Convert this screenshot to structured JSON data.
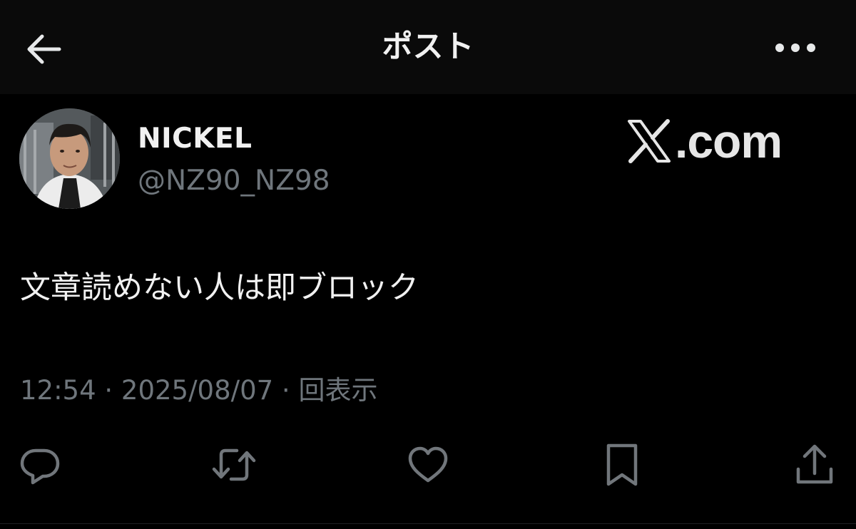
{
  "header": {
    "title": "ポスト",
    "back_icon": "arrow-left-icon",
    "more_icon": "more-horizontal-icon"
  },
  "author": {
    "display_name": "NICKEL",
    "handle": "@NZ90_NZ98"
  },
  "watermark": {
    "text": ".com",
    "logo": "x-logo-icon"
  },
  "tweet": {
    "text": "文章読めない人は即ブロック",
    "meta": "12:54 · 2025/08/07 · 回表示"
  },
  "actions": {
    "reply_icon": "reply-icon",
    "repost_icon": "repost-icon",
    "like_icon": "heart-icon",
    "bookmark_icon": "bookmark-icon",
    "share_icon": "share-icon"
  },
  "colors": {
    "background": "#000000",
    "header_background": "#0a0a0a",
    "primary_text": "#f1f1f1",
    "secondary_text": "#6f767c",
    "icon": "#71767b"
  }
}
